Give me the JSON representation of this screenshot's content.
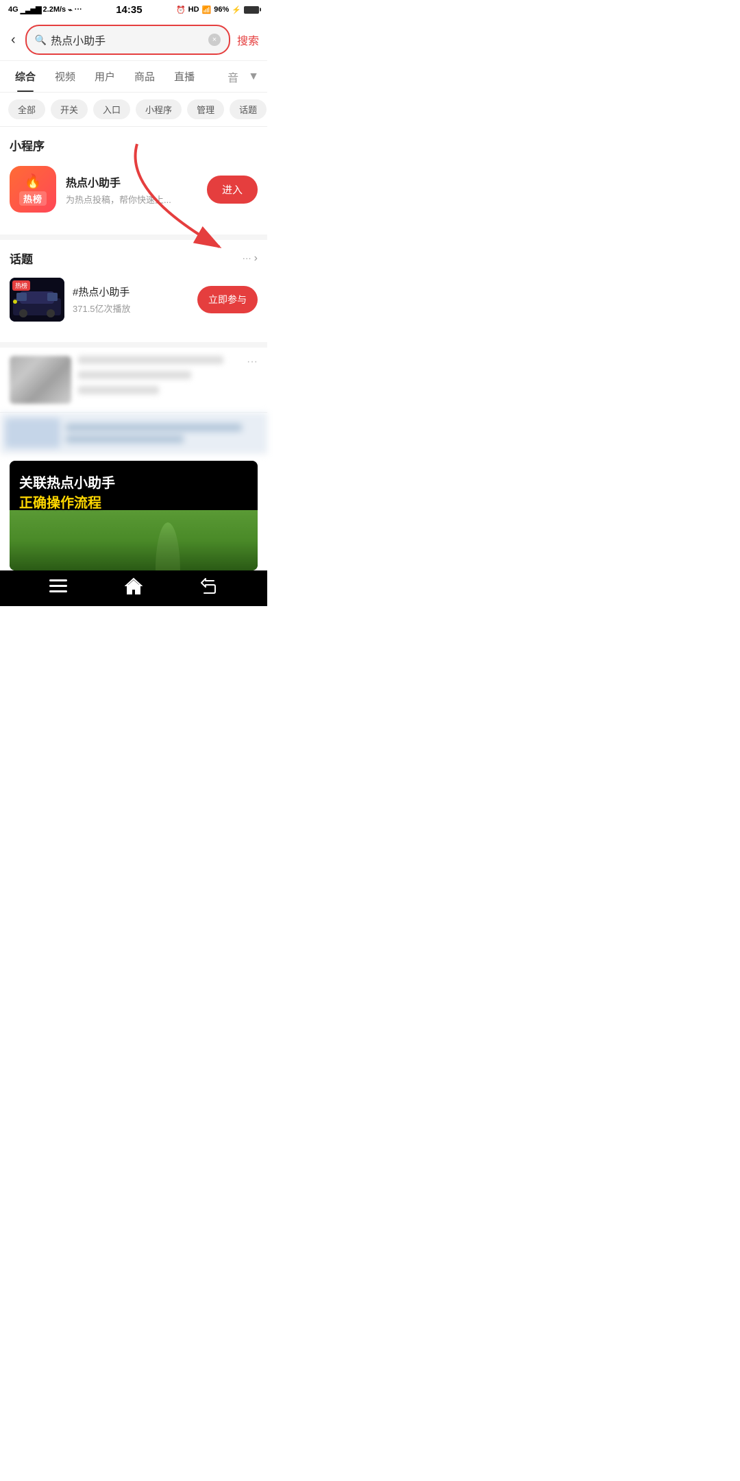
{
  "statusBar": {
    "left": "4G  2.2M/s  ψ  ···",
    "center": "14:35",
    "right": "HD  96%"
  },
  "searchBar": {
    "backLabel": "‹",
    "searchText": "热点小助手",
    "clearLabel": "×",
    "searchBtnLabel": "搜索"
  },
  "tabs": [
    {
      "label": "综合",
      "active": true
    },
    {
      "label": "视频",
      "active": false
    },
    {
      "label": "用户",
      "active": false
    },
    {
      "label": "商品",
      "active": false
    },
    {
      "label": "直播",
      "active": false
    },
    {
      "label": "音",
      "active": false
    }
  ],
  "filterChips": [
    "全部",
    "开关",
    "入口",
    "小程序",
    "管理",
    "话题"
  ],
  "miniProgramSection": {
    "sectionTitle": "小程序",
    "app": {
      "name": "热点小助手",
      "desc": "为热点投稿，帮你快速上...",
      "btnLabel": "进入",
      "iconText": "热榜",
      "iconFlame": "🔥"
    }
  },
  "topicSection": {
    "sectionTitle": "话题",
    "moreLabel": "···",
    "topics": [
      {
        "name": "#热点小助手",
        "plays": "371.5亿次播放",
        "btnLabel": "立即参与",
        "badgeLabel": "热榜"
      }
    ]
  },
  "contentCards": [
    {
      "title": "",
      "hasThumb": true
    }
  ],
  "videoCard": {
    "titleLine1": "关联热点小助手",
    "titleLine2": "正确操作流程"
  },
  "bottomNav": {
    "menuIcon": "☰",
    "homeIcon": "⌂",
    "backIcon": "↩"
  }
}
